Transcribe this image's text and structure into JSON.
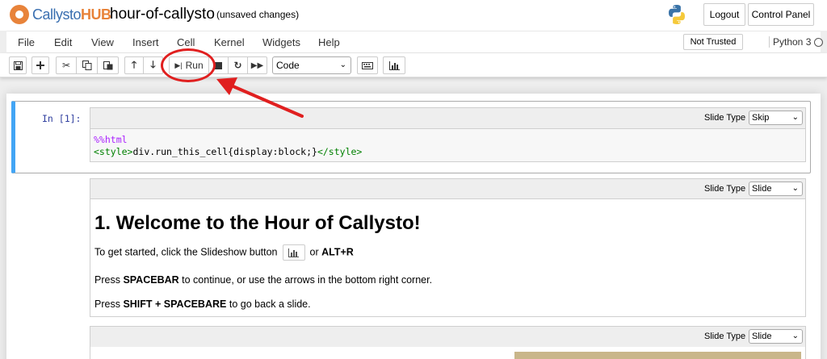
{
  "header": {
    "logo_prefix": "Callysto",
    "logo_suffix": "HUB",
    "notebook_title": "hour-of-callysto",
    "save_status": "(unsaved changes)",
    "logout_label": "Logout",
    "control_panel_label": "Control Panel"
  },
  "menubar": {
    "items": [
      "File",
      "Edit",
      "View",
      "Insert",
      "Cell",
      "Kernel",
      "Widgets",
      "Help"
    ],
    "trust_label": "Not Trusted",
    "kernel_label": "Python 3"
  },
  "toolbar": {
    "run_label": "Run",
    "cell_type_value": "Code"
  },
  "cells": [
    {
      "prompt": "In [1]:",
      "slide_type_label": "Slide Type",
      "slide_type_value": "Skip",
      "code_line1": "%%html",
      "code_line2_open": "<style>",
      "code_line2_body": "div.run_this_cell{display:block;}",
      "code_line2_close": "</style>"
    },
    {
      "slide_type_label": "Slide Type",
      "slide_type_value": "Slide",
      "heading": "1. Welcome to the Hour of Callysto!",
      "p1_prefix": "To get started, click the Slideshow button",
      "p1_mid": "or",
      "p1_bold": "ALT+R",
      "p2_prefix": "Press",
      "p2_bold": "SPACEBAR",
      "p2_suffix": "to continue, or use the arrows in the bottom right corner.",
      "p3_prefix": "Press",
      "p3_bold": "SHIFT + SPACEBARE",
      "p3_suffix": "to go back a slide."
    },
    {
      "slide_type_label": "Slide Type",
      "slide_type_value": "Slide"
    }
  ],
  "colors": {
    "annotation": "#e01f1f",
    "selected_cell_border": "#42a5f5",
    "prompt": "#303f9f"
  }
}
